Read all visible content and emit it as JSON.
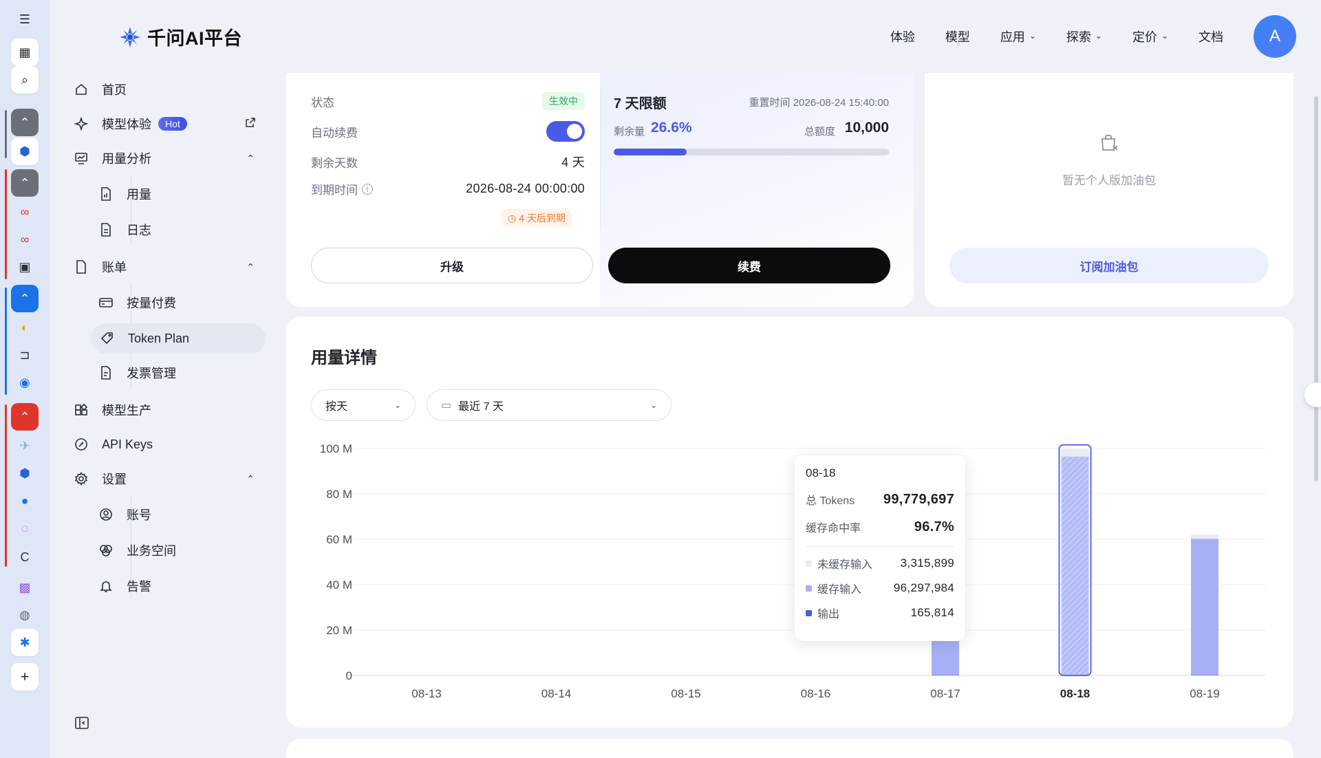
{
  "brand": {
    "name": "千问AI平台"
  },
  "topnav": {
    "items": [
      {
        "label": "体验",
        "dropdown": false
      },
      {
        "label": "模型",
        "dropdown": false
      },
      {
        "label": "应用",
        "dropdown": true
      },
      {
        "label": "探索",
        "dropdown": true
      },
      {
        "label": "定价",
        "dropdown": true
      },
      {
        "label": "文档",
        "dropdown": false
      }
    ],
    "avatar_letter": "A"
  },
  "sidebar": {
    "home": "首页",
    "model_experience": "模型体验",
    "hot_badge": "Hot",
    "usage_analysis": "用量分析",
    "usage": "用量",
    "logs": "日志",
    "billing": "账单",
    "pay_as_you_go": "按量付费",
    "token_plan": "Token Plan",
    "invoice": "发票管理",
    "model_production": "模型生产",
    "api_keys": "API Keys",
    "settings": "设置",
    "account": "账号",
    "workspace": "业务空间",
    "alerts": "告警"
  },
  "plan": {
    "status_label": "状态",
    "status_value": "生效中",
    "auto_renew_label": "自动续费",
    "auto_renew_on": true,
    "days_left_label": "剩余天数",
    "days_left_value": "4 天",
    "expire_label": "到期时间",
    "expire_value": "2026-08-24 00:00:00",
    "expire_badge": "4 天后到期",
    "upgrade_button": "升级",
    "renew_button": "续费"
  },
  "quota": {
    "title": "7 天限额",
    "reset_label": "重置时间 2026-08-24 15:40:00",
    "remain_label": "剩余量",
    "remain_value": "26.6%",
    "remain_fraction": 0.266,
    "total_label": "总额度",
    "total_value": "10,000"
  },
  "addon": {
    "empty_text": "暂无个人版加油包",
    "subscribe_button": "订阅加油包"
  },
  "usage_detail": {
    "title": "用量详情",
    "granularity": "按天",
    "range": "最近 7 天"
  },
  "chart_data": {
    "type": "bar",
    "categories": [
      "08-13",
      "08-14",
      "08-15",
      "08-16",
      "08-17",
      "08-18",
      "08-19"
    ],
    "highlight": "08-18",
    "ylim": [
      0,
      100
    ],
    "yticks": [
      "0",
      "20 M",
      "40 M",
      "60 M",
      "80 M",
      "100 M"
    ],
    "series": [
      {
        "name": "输出",
        "color": "#4b5ae6",
        "values": [
          0,
          0,
          0,
          0,
          0.2,
          0.17,
          0.2
        ]
      },
      {
        "name": "缓存输入",
        "color": "#a7b0f5",
        "values": [
          0,
          0,
          0,
          0,
          91.5,
          96.3,
          60.0
        ]
      },
      {
        "name": "未缓存输入",
        "color": "#e9ebf4",
        "values": [
          0,
          0,
          0,
          0,
          1.8,
          3.3,
          2.0
        ]
      }
    ],
    "grid": true
  },
  "tooltip": {
    "date": "08-18",
    "total_label": "总 Tokens",
    "total_value": "99,779,697",
    "hit_rate_label": "缓存命中率",
    "hit_rate_value": "96.7%",
    "rows": [
      {
        "label": "未缓存输入",
        "value": "3,315,899",
        "color": "#e9ebf4"
      },
      {
        "label": "缓存输入",
        "value": "96,297,984",
        "color": "#a7b0f5"
      },
      {
        "label": "输出",
        "value": "165,814",
        "color": "#4b5ae6"
      }
    ]
  },
  "strip_icons": [
    "menu-icon",
    "grid-icon",
    "search-icon",
    "chevron-up-icon",
    "shield-icon",
    "link-icon",
    "calendar-icon",
    "plus-icon"
  ]
}
